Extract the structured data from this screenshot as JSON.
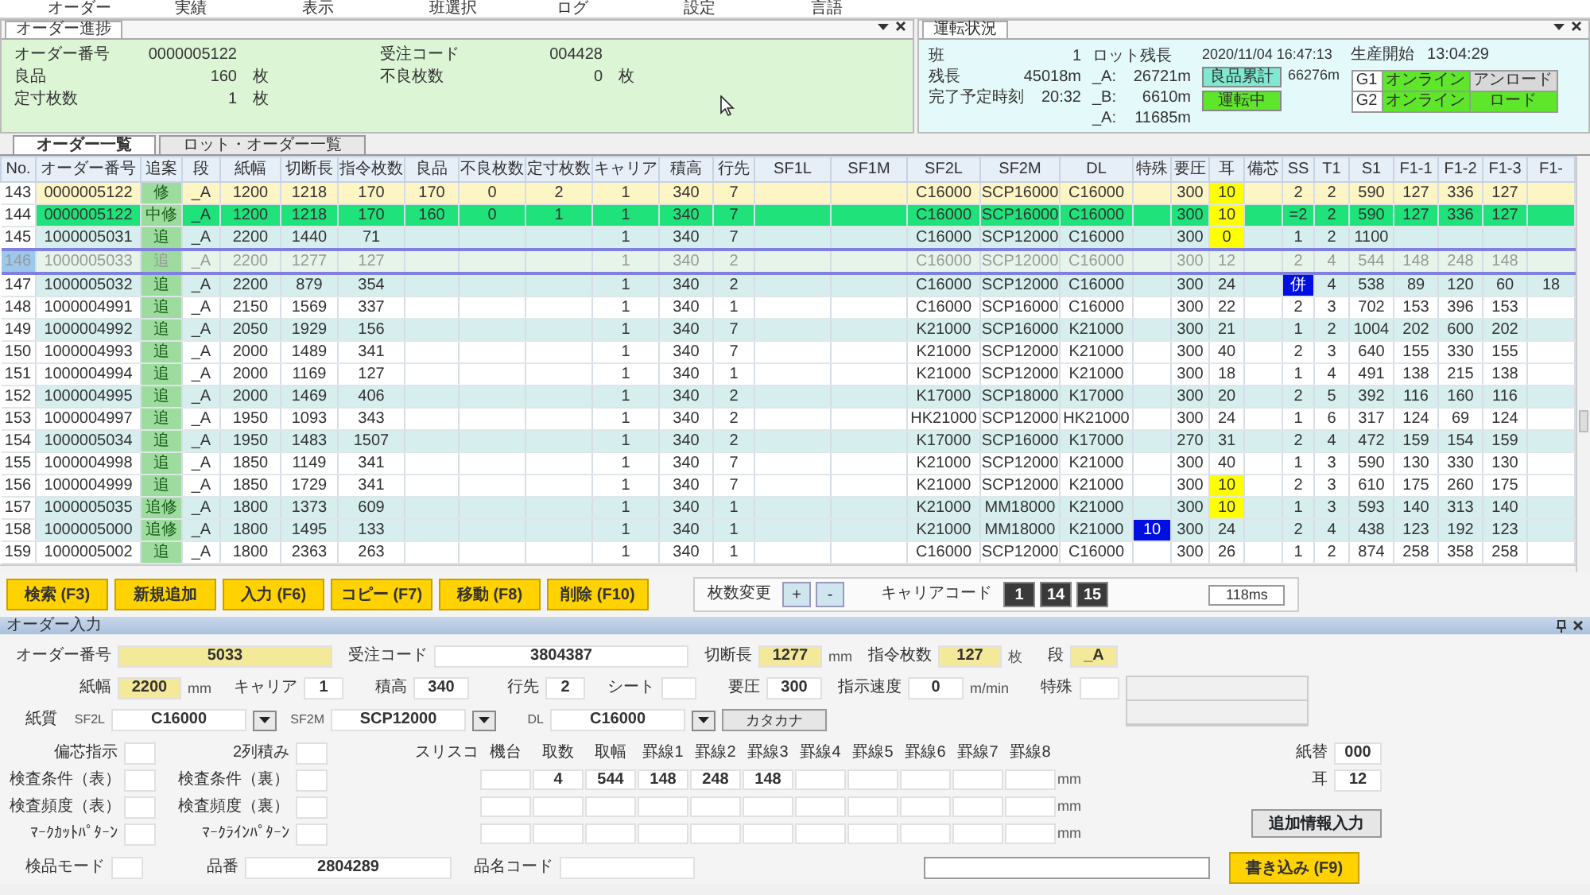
{
  "menu": [
    "オーダー",
    "実績",
    "表示",
    "班選択",
    "ログ",
    "設定",
    "言語"
  ],
  "order_progress": {
    "title": "オーダー進捗",
    "fields": [
      {
        "label": "オーダー番号",
        "value": "0000005122"
      },
      {
        "label": "受注コード",
        "value": "004428"
      },
      {
        "label": "良品",
        "value": "160",
        "unit": "枚"
      },
      {
        "label": "不良枚数",
        "value": "0",
        "unit": "枚"
      },
      {
        "label": "定寸枚数",
        "value": "1",
        "unit": "枚"
      }
    ]
  },
  "operation_status": {
    "title": "運転状況",
    "stats": [
      {
        "label": "班",
        "value": "1"
      },
      {
        "label": "残長",
        "value": "45018m"
      },
      {
        "label": "完了予定時刻",
        "value": "20:32"
      }
    ],
    "lot_remaining": {
      "label": "ロット残長",
      "items": [
        {
          "label": "_A:",
          "value": "26721m"
        },
        {
          "label": "_B:",
          "value": "6610m"
        },
        {
          "label": "_A:",
          "value": "11685m"
        }
      ]
    },
    "datetime": "2020/11/04 16:47:13",
    "total_good": {
      "label": "良品累計",
      "value": "66276m"
    },
    "running": "運転中",
    "production_start": {
      "label": "生産開始",
      "value": "13:04:29"
    },
    "groups": [
      {
        "name": "G1",
        "online": "オンライン",
        "state": "アンロード",
        "loaded": false
      },
      {
        "name": "G2",
        "online": "オンライン",
        "state": "ロード",
        "loaded": true
      }
    ]
  },
  "tabs": [
    {
      "label": "オーダー一覧",
      "selected": true
    },
    {
      "label": "ロット・オーダー一覧",
      "selected": false
    }
  ],
  "table": {
    "columns": [
      "No.",
      "オーダー番号",
      "追案",
      "段",
      "紙幅",
      "切断長",
      "指令枚数",
      "良品",
      "不良枚数",
      "定寸枚数",
      "キャリア",
      "積高",
      "行先",
      "SF1L",
      "SF1M",
      "SF2L",
      "SF2M",
      "DL",
      "特殊",
      "要圧",
      "耳",
      "備芯",
      "SS",
      "T1",
      "S1",
      "F1-1",
      "F1-2",
      "F1-3",
      "F1-"
    ],
    "rows": [
      {
        "color": "#fdf5c4",
        "selected": false,
        "special_marked": false,
        "ear_marked": true,
        "ss_marked": false,
        "cells": [
          "143",
          "0000005122",
          "修",
          "_A",
          "1200",
          "1218",
          "170",
          "170",
          "0",
          "2",
          "1",
          "340",
          "7",
          null,
          null,
          "C16000",
          "SCP16000",
          "C16000",
          null,
          "300",
          "10",
          null,
          "2",
          "2",
          "590",
          "127",
          "336",
          "127",
          null
        ]
      },
      {
        "color": "#1fe27a",
        "selected": false,
        "special_marked": false,
        "ear_marked": true,
        "ss_marked": false,
        "cells": [
          "144",
          "0000005122",
          "中修",
          "_A",
          "1200",
          "1218",
          "170",
          "160",
          "0",
          "1",
          "1",
          "340",
          "7",
          null,
          null,
          "C16000",
          "SCP16000",
          "C16000",
          null,
          "300",
          "10",
          null,
          "=2",
          "2",
          "590",
          "127",
          "336",
          "127",
          null
        ]
      },
      {
        "color": "#d6eeee",
        "selected": false,
        "special_marked": false,
        "ear_marked": true,
        "ss_marked": false,
        "cells": [
          "145",
          "1000005031",
          "追",
          "_A",
          "2200",
          "1440",
          "71",
          null,
          null,
          null,
          "1",
          "340",
          "7",
          null,
          null,
          "C16000",
          "SCP12000",
          "C16000",
          null,
          "300",
          "0",
          null,
          "1",
          "2",
          "1100",
          null,
          null,
          null,
          null
        ]
      },
      {
        "color": "#e6f4ea",
        "selected": true,
        "special_marked": false,
        "ear_marked": false,
        "ss_marked": false,
        "cells": [
          "146",
          "1000005033",
          "追",
          "_A",
          "2200",
          "1277",
          "127",
          null,
          null,
          null,
          "1",
          "340",
          "2",
          null,
          null,
          "C16000",
          "SCP12000",
          "C16000",
          null,
          "300",
          "12",
          null,
          "2",
          "4",
          "544",
          "148",
          "248",
          "148",
          null
        ]
      },
      {
        "color": "#d6eeee",
        "selected": false,
        "special_marked": false,
        "ear_marked": false,
        "ss_marked": true,
        "cells": [
          "147",
          "1000005032",
          "追",
          "_A",
          "2200",
          "879",
          "354",
          null,
          null,
          null,
          "1",
          "340",
          "2",
          null,
          null,
          "C16000",
          "SCP12000",
          "C16000",
          null,
          "300",
          "24",
          null,
          "併",
          "4",
          "538",
          "89",
          "120",
          "60",
          "18"
        ]
      },
      {
        "color": "#ffffff",
        "selected": false,
        "special_marked": false,
        "ear_marked": false,
        "ss_marked": false,
        "cells": [
          "148",
          "1000004991",
          "追",
          "_A",
          "2150",
          "1569",
          "337",
          null,
          null,
          null,
          "1",
          "340",
          "1",
          null,
          null,
          "C16000",
          "SCP16000",
          "C16000",
          null,
          "300",
          "22",
          null,
          "2",
          "3",
          "702",
          "153",
          "396",
          "153",
          null
        ]
      },
      {
        "color": "#d6eeee",
        "selected": false,
        "special_marked": false,
        "ear_marked": false,
        "ss_marked": false,
        "cells": [
          "149",
          "1000004992",
          "追",
          "_A",
          "2050",
          "1929",
          "156",
          null,
          null,
          null,
          "1",
          "340",
          "7",
          null,
          null,
          "K21000",
          "SCP16000",
          "K21000",
          null,
          "300",
          "21",
          null,
          "1",
          "2",
          "1004",
          "202",
          "600",
          "202",
          null
        ]
      },
      {
        "color": "#ffffff",
        "selected": false,
        "special_marked": false,
        "ear_marked": false,
        "ss_marked": false,
        "cells": [
          "150",
          "1000004993",
          "追",
          "_A",
          "2000",
          "1489",
          "341",
          null,
          null,
          null,
          "1",
          "340",
          "7",
          null,
          null,
          "K21000",
          "SCP12000",
          "K21000",
          null,
          "300",
          "40",
          null,
          "2",
          "3",
          "640",
          "155",
          "330",
          "155",
          null
        ]
      },
      {
        "color": "#ffffff",
        "selected": false,
        "special_marked": false,
        "ear_marked": false,
        "ss_marked": false,
        "cells": [
          "151",
          "1000004994",
          "追",
          "_A",
          "2000",
          "1169",
          "127",
          null,
          null,
          null,
          "1",
          "340",
          "1",
          null,
          null,
          "K21000",
          "SCP12000",
          "K21000",
          null,
          "300",
          "18",
          null,
          "1",
          "4",
          "491",
          "138",
          "215",
          "138",
          null
        ]
      },
      {
        "color": "#d6eeee",
        "selected": false,
        "special_marked": false,
        "ear_marked": false,
        "ss_marked": false,
        "cells": [
          "152",
          "1000004995",
          "追",
          "_A",
          "2000",
          "1469",
          "406",
          null,
          null,
          null,
          "1",
          "340",
          "2",
          null,
          null,
          "K17000",
          "SCP18000",
          "K17000",
          null,
          "300",
          "20",
          null,
          "2",
          "5",
          "392",
          "116",
          "160",
          "116",
          null
        ]
      },
      {
        "color": "#ffffff",
        "selected": false,
        "special_marked": false,
        "ear_marked": false,
        "ss_marked": false,
        "cells": [
          "153",
          "1000004997",
          "追",
          "_A",
          "1950",
          "1093",
          "343",
          null,
          null,
          null,
          "1",
          "340",
          "2",
          null,
          null,
          "HK21000",
          "SCP12000",
          "HK21000",
          null,
          "300",
          "24",
          null,
          "1",
          "6",
          "317",
          "124",
          "69",
          "124",
          null
        ]
      },
      {
        "color": "#d6eeee",
        "selected": false,
        "special_marked": false,
        "ear_marked": false,
        "ss_marked": false,
        "cells": [
          "154",
          "1000005034",
          "追",
          "_A",
          "1950",
          "1483",
          "1507",
          null,
          null,
          null,
          "1",
          "340",
          "2",
          null,
          null,
          "K17000",
          "SCP16000",
          "K17000",
          null,
          "270",
          "31",
          null,
          "2",
          "4",
          "472",
          "159",
          "154",
          "159",
          null
        ]
      },
      {
        "color": "#ffffff",
        "selected": false,
        "special_marked": false,
        "ear_marked": false,
        "ss_marked": false,
        "cells": [
          "155",
          "1000004998",
          "追",
          "_A",
          "1850",
          "1149",
          "341",
          null,
          null,
          null,
          "1",
          "340",
          "7",
          null,
          null,
          "K21000",
          "SCP12000",
          "K21000",
          null,
          "300",
          "40",
          null,
          "1",
          "3",
          "590",
          "130",
          "330",
          "130",
          null
        ]
      },
      {
        "color": "#ffffff",
        "selected": false,
        "special_marked": false,
        "ear_marked": true,
        "ss_marked": false,
        "cells": [
          "156",
          "1000004999",
          "追",
          "_A",
          "1850",
          "1729",
          "341",
          null,
          null,
          null,
          "1",
          "340",
          "7",
          null,
          null,
          "K21000",
          "SCP12000",
          "K21000",
          null,
          "300",
          "10",
          null,
          "2",
          "3",
          "610",
          "175",
          "260",
          "175",
          null
        ]
      },
      {
        "color": "#d6eeee",
        "selected": false,
        "special_marked": false,
        "ear_marked": true,
        "ss_marked": false,
        "cells": [
          "157",
          "1000005035",
          "追修",
          "_A",
          "1800",
          "1373",
          "609",
          null,
          null,
          null,
          "1",
          "340",
          "1",
          null,
          null,
          "K21000",
          "MM18000",
          "K21000",
          null,
          "300",
          "10",
          null,
          "1",
          "3",
          "593",
          "140",
          "313",
          "140",
          null
        ]
      },
      {
        "color": "#d6eeee",
        "selected": false,
        "special_marked": true,
        "ear_marked": false,
        "ss_marked": false,
        "cells": [
          "158",
          "1000005000",
          "追修",
          "_A",
          "1800",
          "1495",
          "133",
          null,
          null,
          null,
          "1",
          "340",
          "1",
          null,
          null,
          "K21000",
          "MM18000",
          "K21000",
          "10",
          "300",
          "24",
          null,
          "2",
          "4",
          "438",
          "123",
          "192",
          "123",
          null
        ]
      },
      {
        "color": "#ffffff",
        "selected": false,
        "special_marked": false,
        "ear_marked": false,
        "ss_marked": false,
        "cells": [
          "159",
          "1000005002",
          "追",
          "_A",
          "1800",
          "2363",
          "263",
          null,
          null,
          null,
          "1",
          "340",
          "1",
          null,
          null,
          "C16000",
          "SCP12000",
          "C16000",
          null,
          "300",
          "26",
          null,
          "1",
          "2",
          "874",
          "258",
          "358",
          "258",
          null
        ]
      }
    ]
  },
  "actions": [
    "検索 (F3)",
    "新規追加",
    "入力 (F6)",
    "コピー (F7)",
    "移動 (F8)",
    "削除 (F10)"
  ],
  "count_change": {
    "label": "枚数変更",
    "buttons": [
      "+",
      "-"
    ]
  },
  "carrier_code": {
    "label": "キャリアコード",
    "buttons": [
      "1",
      "14",
      "15"
    ]
  },
  "timing": "118ms",
  "order_input": {
    "title": "オーダー入力",
    "row1": [
      {
        "label": "オーダー番号",
        "value": "5033",
        "highlighted": true
      },
      {
        "label": "受注コード",
        "value": "3804387",
        "highlighted": false
      },
      {
        "label": "切断長",
        "value": "1277",
        "unit": "mm",
        "highlighted": true
      },
      {
        "label": "指令枚数",
        "value": "127",
        "unit": "枚",
        "highlighted": true
      },
      {
        "label": "段",
        "value": "_A",
        "highlighted": true
      }
    ],
    "row2": [
      {
        "label": "紙幅",
        "value": "2200",
        "unit": "mm",
        "highlighted": true
      },
      {
        "label": "キャリア",
        "value": "1",
        "highlighted": false
      },
      {
        "label": "積高",
        "value": "340",
        "highlighted": false
      },
      {
        "label": "行先",
        "value": "2",
        "highlighted": false
      },
      {
        "label": "シート",
        "highlighted": false
      },
      {
        "label": "要圧",
        "value": "300",
        "highlighted": false
      },
      {
        "label": "指示速度",
        "value": "0",
        "unit": "m/min",
        "highlighted": false
      },
      {
        "label": "特殊",
        "highlighted": false
      }
    ],
    "paper_quality": {
      "label": "紙質",
      "selects": [
        {
          "label": "SF2L",
          "value": "C16000"
        },
        {
          "label": "SF2M",
          "value": "SCP12000"
        },
        {
          "label": "DL",
          "value": "C16000"
        }
      ],
      "button": "カタカナ"
    },
    "options": [
      [
        {
          "label": "偏芯指示"
        },
        {
          "label": "2列積み"
        }
      ],
      [
        {
          "label": "検査条件（表）"
        },
        {
          "label": "検査条件（裏）"
        }
      ],
      [
        {
          "label": "検査頻度（表）"
        },
        {
          "label": "検査頻度（裏）"
        }
      ],
      [
        {
          "label": "ﾏｰｸｶｯﾄﾊﾟﾀｰﾝ"
        },
        {
          "label": "ﾏｰｸﾗｲﾝﾊﾟﾀｰﾝ"
        }
      ]
    ],
    "slitter": {
      "label": "スリスコ",
      "columns": [
        "機台",
        "取数",
        "取幅",
        "罫線1",
        "罫線2",
        "罫線3",
        "罫線4",
        "罫線5",
        "罫線6",
        "罫線7",
        "罫線8"
      ],
      "rows": [
        {
          "cells": [
            null,
            "4",
            "544",
            "148",
            "248",
            "148",
            null,
            null,
            null,
            null,
            null
          ],
          "unit": "mm"
        },
        {
          "cells": [
            null,
            null,
            null,
            null,
            null,
            null,
            null,
            null,
            null,
            null,
            null
          ],
          "unit": "mm"
        },
        {
          "cells": [
            null,
            null,
            null,
            null,
            null,
            null,
            null,
            null,
            null,
            null,
            null
          ],
          "unit": "mm"
        }
      ]
    },
    "paper_change": {
      "label": "紙替",
      "value": "000"
    },
    "ear": {
      "label": "耳",
      "value": "12"
    },
    "extra_button": "追加情報入力",
    "product": [
      {
        "label": "検品モード"
      },
      {
        "label": "品番",
        "value": "2804289"
      },
      {
        "label": "品名コード"
      }
    ],
    "write_button": "書き込み (F9)"
  }
}
